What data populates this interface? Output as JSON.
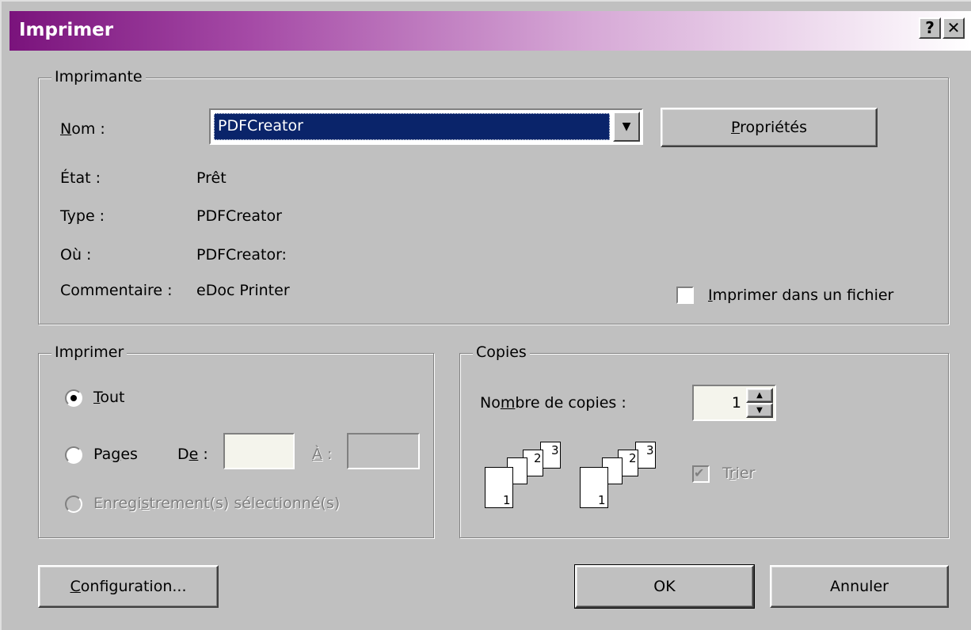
{
  "window": {
    "title": "Imprimer",
    "help_label": "?",
    "close_label": "✕"
  },
  "printer_group": {
    "legend": "Imprimante",
    "name_label": "Nom :",
    "name_value": "PDFCreator",
    "properties_label": "Propriétés",
    "status_label": "État :",
    "status_value": "Prêt",
    "type_label": "Type :",
    "type_value": "PDFCreator",
    "where_label": "Où :",
    "where_value": "PDFCreator:",
    "comment_label": "Commentaire :",
    "comment_value": "eDoc Printer",
    "print_to_file_label": "Imprimer dans un fichier",
    "print_to_file_checked": false
  },
  "print_range": {
    "legend": "Imprimer",
    "all_label": "Tout",
    "pages_label": "Pages",
    "from_label": "De :",
    "to_label": "À :",
    "selection_label": "Enregistrement(s) sélectionné(s)",
    "selected": "all"
  },
  "copies": {
    "legend": "Copies",
    "count_label": "Nombre de copies :",
    "count_value": "1",
    "collate_label": "Trier",
    "collate_checked": true,
    "page_numbers": [
      "1",
      "2",
      "3"
    ]
  },
  "buttons": {
    "setup": "Configuration...",
    "ok": "OK",
    "cancel": "Annuler"
  }
}
